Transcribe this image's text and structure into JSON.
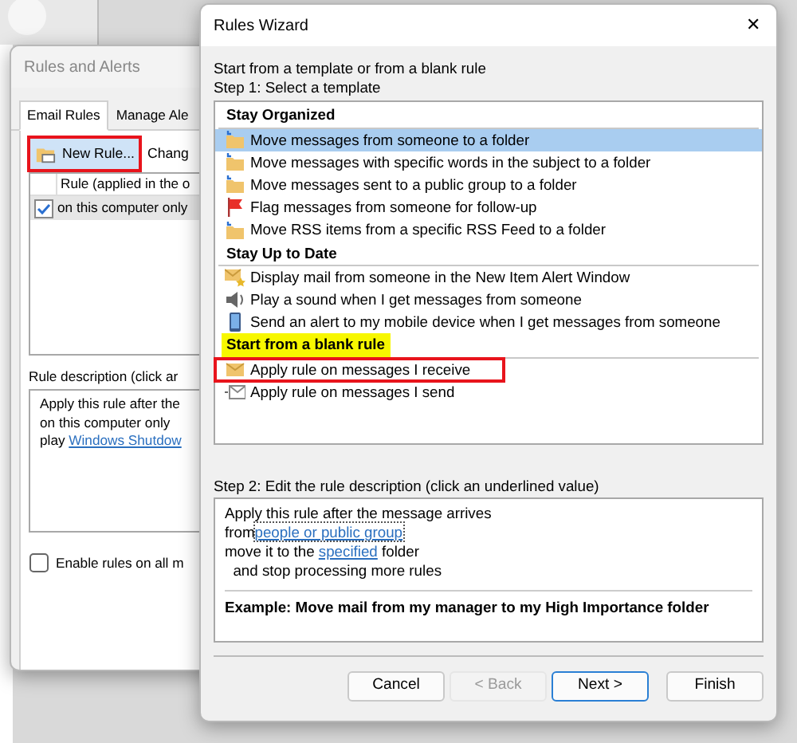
{
  "rules_and_alerts": {
    "title": "Rules and Alerts",
    "tabs": [
      {
        "label": "Email Rules",
        "selected": true
      },
      {
        "label": "Manage Ale",
        "selected": false
      }
    ],
    "toolbar": [
      {
        "kind": "new",
        "label": "New Rule...",
        "highlighted": true
      },
      {
        "kind": "change",
        "label": "Chang",
        "highlighted": false
      }
    ],
    "column_header": "Rule (applied in the o",
    "rules": [
      {
        "label": "on this computer only",
        "checked": true,
        "selected": true
      }
    ],
    "description_label": "Rule description (click ar",
    "description_lines": [
      [
        {
          "kind": "text",
          "text": "Apply this rule after the"
        }
      ],
      [
        {
          "kind": "text",
          "text": "on this computer only"
        }
      ],
      [
        {
          "kind": "text",
          "text": "play "
        },
        {
          "kind": "link",
          "text": "Windows Shutdow"
        }
      ]
    ],
    "enable_all": {
      "label": "Enable rules on all m",
      "checked": false
    }
  },
  "wizard": {
    "title": "Rules Wizard",
    "close": "✕",
    "intro": "Start from a template or from a blank rule",
    "step1": "Step 1: Select a template",
    "groups": [
      {
        "heading": "Stay Organized",
        "marked": false,
        "items": [
          {
            "kind": "move",
            "label": "Move messages from someone to a folder",
            "selected": true,
            "highlighted": false
          },
          {
            "kind": "move",
            "label": "Move messages with specific words in the subject to a folder",
            "selected": false,
            "highlighted": false
          },
          {
            "kind": "move",
            "label": "Move messages sent to a public group to a folder",
            "selected": false,
            "highlighted": false
          },
          {
            "kind": "flag",
            "label": "Flag messages from someone for follow-up",
            "selected": false,
            "highlighted": false
          },
          {
            "kind": "move",
            "label": "Move RSS items from a specific RSS Feed to a folder",
            "selected": false,
            "highlighted": false
          }
        ]
      },
      {
        "heading": "Stay Up to Date",
        "marked": false,
        "items": [
          {
            "kind": "alert",
            "label": "Display mail from someone in the New Item Alert Window",
            "selected": false,
            "highlighted": false
          },
          {
            "kind": "sound",
            "label": "Play a sound when I get messages from someone",
            "selected": false,
            "highlighted": false
          },
          {
            "kind": "mobile",
            "label": "Send an alert to my mobile device when I get messages from someone",
            "selected": false,
            "highlighted": false
          }
        ]
      },
      {
        "heading": "Start from a blank rule",
        "marked": true,
        "items": [
          {
            "kind": "receive",
            "label": "Apply rule on messages I receive",
            "selected": false,
            "highlighted": true
          },
          {
            "kind": "send",
            "label": "Apply rule on messages I send",
            "selected": false,
            "highlighted": false
          }
        ]
      }
    ],
    "step2": "Step 2: Edit the rule description (click an underlined value)",
    "description_lines": [
      [
        {
          "kind": "text",
          "text": "Apply this rule after the message arrives"
        }
      ],
      [
        {
          "kind": "text",
          "text": "from"
        },
        {
          "kind": "link",
          "text": "people or public group",
          "focused": true
        }
      ],
      [
        {
          "kind": "text",
          "text": "move it to the "
        },
        {
          "kind": "link",
          "text": "specified",
          "focused": false
        },
        {
          "kind": "text",
          "text": " folder"
        }
      ],
      [
        {
          "kind": "text",
          "text": "  and stop processing more rules"
        }
      ]
    ],
    "example": "Example: Move mail from my manager to my High Importance folder",
    "buttons": [
      {
        "label": "Cancel",
        "disabled": false,
        "default": false
      },
      {
        "label": "< Back",
        "disabled": true,
        "default": false
      },
      {
        "label": "Next >",
        "disabled": false,
        "default": true
      },
      {
        "label": "Finish",
        "disabled": false,
        "default": false
      }
    ]
  }
}
